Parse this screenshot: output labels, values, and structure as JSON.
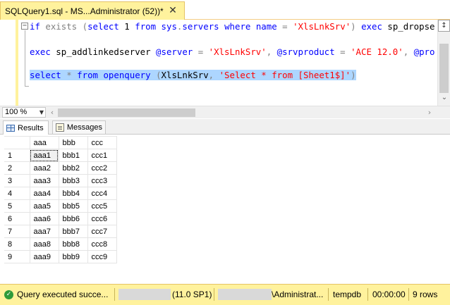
{
  "tab": {
    "title": "SQLQuery1.sql - MS...Administrator (52))*",
    "close_glyph": "✕"
  },
  "editor": {
    "fold_glyph": "−",
    "line1": [
      {
        "t": "if",
        "c": "kw"
      },
      {
        "t": " exists ",
        "c": "gr"
      },
      {
        "t": "(",
        "c": "gr"
      },
      {
        "t": "select",
        "c": "kw"
      },
      {
        "t": " 1 ",
        "c": "tx"
      },
      {
        "t": "from",
        "c": "kw"
      },
      {
        "t": " sys",
        "c": "fn"
      },
      {
        "t": ".",
        "c": "gr"
      },
      {
        "t": "servers ",
        "c": "fn"
      },
      {
        "t": "where",
        "c": "kw"
      },
      {
        "t": " name ",
        "c": "fn"
      },
      {
        "t": "=",
        "c": "gr"
      },
      {
        "t": " ",
        "c": "tx"
      },
      {
        "t": "'XlsLnkSrv'",
        "c": "str"
      },
      {
        "t": ") ",
        "c": "gr"
      },
      {
        "t": "exec",
        "c": "kw"
      },
      {
        "t": " sp_dropse",
        "c": "tx"
      }
    ],
    "line2": [
      {
        "t": "exec",
        "c": "kw"
      },
      {
        "t": " sp_addlinkedserver ",
        "c": "tx"
      },
      {
        "t": "@server",
        "c": "fn"
      },
      {
        "t": " = ",
        "c": "gr"
      },
      {
        "t": "'XlsLnkSrv'",
        "c": "str"
      },
      {
        "t": ", ",
        "c": "gr"
      },
      {
        "t": "@srvproduct",
        "c": "fn"
      },
      {
        "t": " = ",
        "c": "gr"
      },
      {
        "t": "'ACE 12.0'",
        "c": "str"
      },
      {
        "t": ", ",
        "c": "gr"
      },
      {
        "t": "@pro",
        "c": "fn"
      }
    ],
    "line3": [
      {
        "t": "select",
        "c": "kw"
      },
      {
        "t": " * ",
        "c": "gr"
      },
      {
        "t": "from",
        "c": "kw"
      },
      {
        "t": " openquery ",
        "c": "fn"
      },
      {
        "t": "(",
        "c": "gr"
      },
      {
        "t": "XlsLnkSrv",
        "c": "tx"
      },
      {
        "t": ", ",
        "c": "gr"
      },
      {
        "t": "'Select * from [Sheet1$]'",
        "c": "str"
      },
      {
        "t": ")",
        "c": "gr"
      }
    ]
  },
  "scroll": {
    "split_glyph": "↕",
    "down_glyph": "⌄",
    "left_glyph": "‹",
    "right_glyph": "›"
  },
  "zoom": {
    "value": "100 %",
    "arrow_glyph": "▼"
  },
  "results_tabs": {
    "results_label": "Results",
    "messages_label": "Messages"
  },
  "grid": {
    "columns": [
      "aaa",
      "bbb",
      "ccc"
    ],
    "rows": [
      {
        "n": "1",
        "cells": [
          "aaa1",
          "bbb1",
          "ccc1"
        ]
      },
      {
        "n": "2",
        "cells": [
          "aaa2",
          "bbb2",
          "ccc2"
        ]
      },
      {
        "n": "3",
        "cells": [
          "aaa3",
          "bbb3",
          "ccc3"
        ]
      },
      {
        "n": "4",
        "cells": [
          "aaa4",
          "bbb4",
          "ccc4"
        ]
      },
      {
        "n": "5",
        "cells": [
          "aaa5",
          "bbb5",
          "ccc5"
        ]
      },
      {
        "n": "6",
        "cells": [
          "aaa6",
          "bbb6",
          "ccc6"
        ]
      },
      {
        "n": "7",
        "cells": [
          "aaa7",
          "bbb7",
          "ccc7"
        ]
      },
      {
        "n": "8",
        "cells": [
          "aaa8",
          "bbb8",
          "ccc8"
        ]
      },
      {
        "n": "9",
        "cells": [
          "aaa9",
          "bbb9",
          "ccc9"
        ]
      }
    ]
  },
  "status": {
    "ok_glyph": "✓",
    "message": "Query executed succe...",
    "version": "(11.0 SP1)",
    "user": "\\Administrat...",
    "database": "tempdb",
    "elapsed": "00:00:00",
    "rows": "9 rows"
  },
  "colors": {
    "tab_active": "#fff29d",
    "status_bar": "#fff29d",
    "keyword": "#0000ff",
    "string": "#ff0000",
    "selection": "#add6ff"
  }
}
